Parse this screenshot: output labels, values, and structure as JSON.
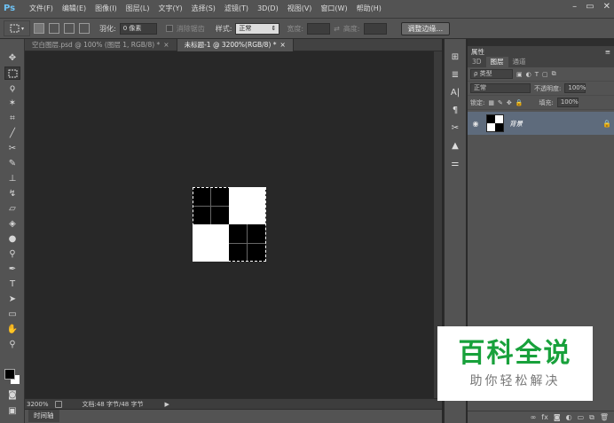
{
  "app": {
    "logo": "Ps"
  },
  "menu": [
    "文件(F)",
    "编辑(E)",
    "图像(I)",
    "图层(L)",
    "文字(Y)",
    "选择(S)",
    "滤镜(T)",
    "3D(D)",
    "视图(V)",
    "窗口(W)",
    "帮助(H)"
  ],
  "window_buttons": {
    "minimize": "–",
    "restore": "▭",
    "close": "✕"
  },
  "options": {
    "feather_label": "羽化:",
    "feather_value": "0 像素",
    "antialias_label": "消除锯齿",
    "style_label": "样式:",
    "style_value": "正常",
    "width_label": "宽度:",
    "height_label": "高度:",
    "refine_edge_button": "调整边缘..."
  },
  "tabs": [
    {
      "label": "空白图层.psd @ 100% (图层 1, RGB/8) *",
      "close": "×",
      "active": false
    },
    {
      "label": "未标题-1 @ 3200%(RGB/8) *",
      "close": "×",
      "active": true
    }
  ],
  "status": {
    "zoom": "3200%",
    "doc_info": "文档:48 字节/48 字节"
  },
  "timeline": {
    "label": "时间轴"
  },
  "panel": {
    "title": "属性",
    "tabs": [
      "3D",
      "图层",
      "通道"
    ],
    "active_tab": "图层",
    "kind_filter": "ρ 类型",
    "blend_mode": "正常",
    "opacity_label": "不透明度:",
    "opacity_value": "100%",
    "lock_label": "锁定:",
    "fill_label": "填充:",
    "fill_value": "100%",
    "layers": [
      {
        "name": "背景",
        "visible": true,
        "locked": true
      }
    ]
  },
  "watermark": {
    "title": "百科全说",
    "subtitle": "助你轻松解决"
  },
  "colors": {
    "foreground": "#000000",
    "background": "#ffffff",
    "accent": "#18a13b",
    "selected_layer": "#5e6b7c"
  }
}
